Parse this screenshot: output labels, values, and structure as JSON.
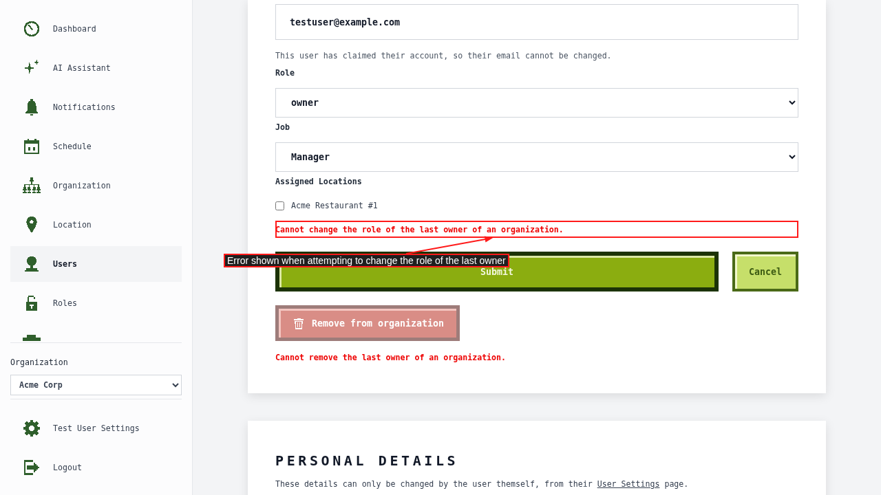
{
  "sidebar": {
    "nav_items": [
      {
        "label": "Dashboard",
        "selected": false
      },
      {
        "label": "AI Assistant",
        "selected": false
      },
      {
        "label": "Notifications",
        "selected": false
      },
      {
        "label": "Schedule",
        "selected": false
      },
      {
        "label": "Organization",
        "selected": false
      },
      {
        "label": "Location",
        "selected": false
      },
      {
        "label": "Users",
        "selected": true
      },
      {
        "label": "Roles",
        "selected": false
      }
    ],
    "organization": {
      "label": "Organization",
      "value": "Acme Corp"
    },
    "footer_items": [
      {
        "label": "Test User Settings"
      },
      {
        "label": "Logout"
      }
    ]
  },
  "user_form": {
    "email": {
      "value": "testuser@example.com",
      "help": "This user has claimed their account, so their email cannot be changed."
    },
    "role": {
      "label": "Role",
      "value": "owner"
    },
    "job": {
      "label": "Job",
      "value": "Manager"
    },
    "locations": {
      "label": "Assigned Locations",
      "options": [
        {
          "label": "Acme Restaurant #1",
          "checked": false
        }
      ]
    },
    "role_error": "Cannot change the role of the last owner of an organization.",
    "submit_button": "Submit",
    "cancel_button": "Cancel",
    "remove_button": {
      "label": "Remove from organization",
      "disabled": true
    },
    "remove_error": "Cannot remove the last owner of an organization."
  },
  "personal_details": {
    "title": "PERSONAL DETAILS",
    "note": {
      "before": "These details can only be changed by the user themself, from their ",
      "link": "User Settings",
      "after": " page."
    }
  },
  "annotation": {
    "label": "Error shown when attempting to change the role of the last owner"
  }
}
